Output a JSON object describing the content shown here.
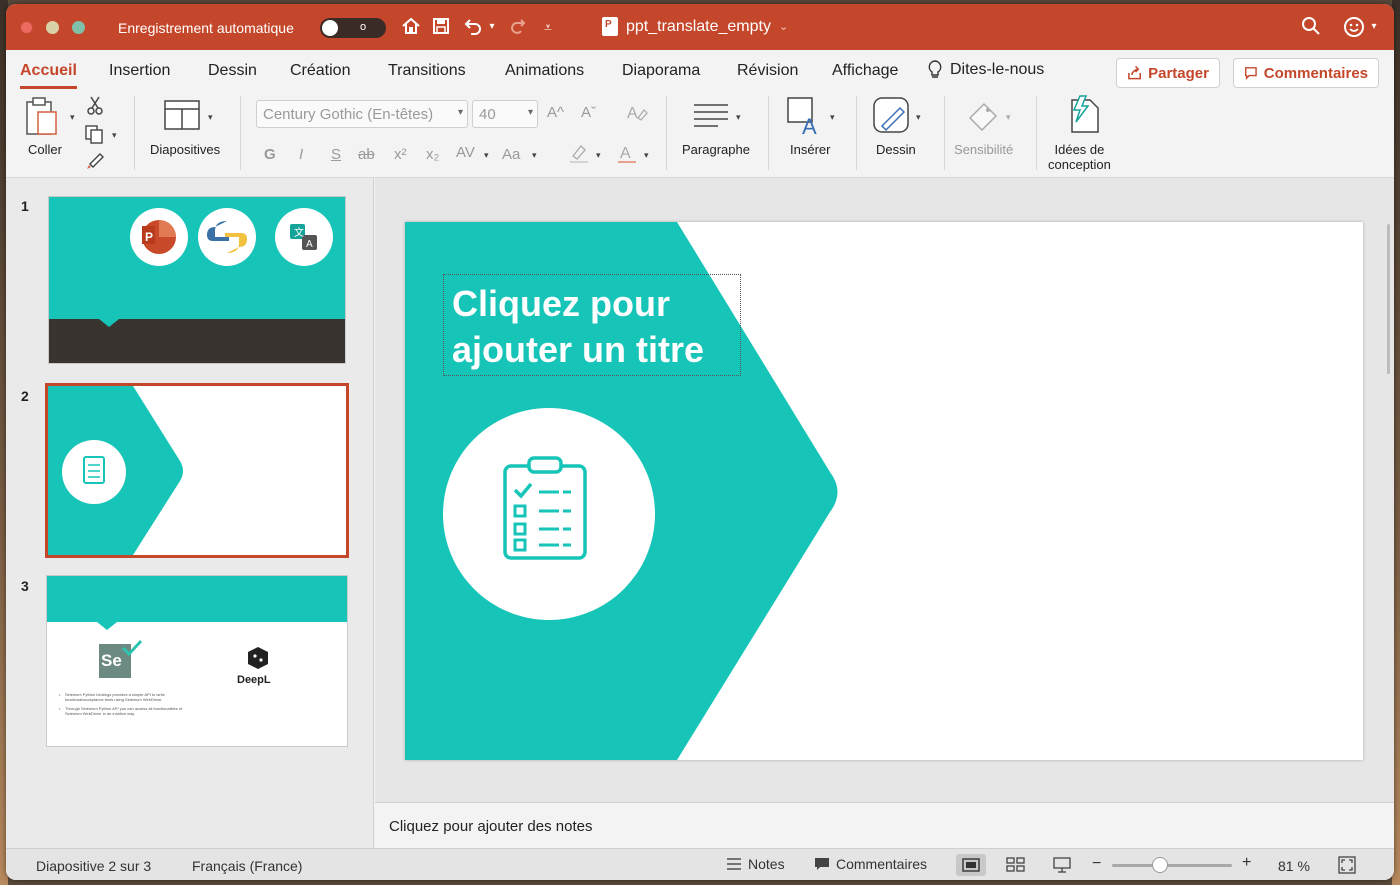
{
  "titlebar": {
    "autosave_label": "Enregistrement automatique",
    "autosave_state": "o",
    "doc_title": "ppt_translate_empty"
  },
  "tabs": [
    {
      "label": "Accueil",
      "active": true
    },
    {
      "label": "Insertion"
    },
    {
      "label": "Dessin"
    },
    {
      "label": "Création"
    },
    {
      "label": "Transitions"
    },
    {
      "label": "Animations"
    },
    {
      "label": "Diaporama"
    },
    {
      "label": "Révision"
    },
    {
      "label": "Affichage"
    }
  ],
  "tell_me": "Dites-le-nous",
  "share_label": "Partager",
  "comments_label": "Commentaires",
  "ribbon": {
    "paste": "Coller",
    "slides": "Diapositives",
    "font_name": "Century Gothic (En-têtes)",
    "font_size": "40",
    "paragraph": "Paragraphe",
    "insert": "Insérer",
    "draw": "Dessin",
    "sensitivity": "Sensibilité",
    "designer_line1": "Idées de",
    "designer_line2": "conception",
    "format_glyphs": {
      "bold": "G",
      "italic": "I",
      "underline": "S",
      "strike": "ab",
      "super": "x²",
      "sub": "x₂",
      "spacing": "AV",
      "case": "Aa",
      "grow": "A^",
      "shrink": "Aˇ"
    }
  },
  "thumbnails": [
    {
      "num": "1"
    },
    {
      "num": "2",
      "selected": true
    },
    {
      "num": "3",
      "bullets": [
        "Selenium Python bindings provides a simple API to write functional/acceptance tests using Selenium WebDriver.",
        "Through Selenium Python API you can access all functionalities of Selenium WebDriver in an intuitive way."
      ],
      "logo_se": "Se",
      "logo_deepl": "DeepL"
    }
  ],
  "slide": {
    "title_line1": "Cliquez pour",
    "title_line2": "ajouter un titre"
  },
  "notes_placeholder": "Cliquez pour ajouter des notes",
  "status": {
    "slide_info": "Diapositive 2 sur 3",
    "language": "Français (France)",
    "notes": "Notes",
    "comments": "Commentaires",
    "zoom": "81 %"
  },
  "colors": {
    "accent": "#c5472b",
    "teal": "#16c4b8",
    "dark": "#3a3431"
  }
}
